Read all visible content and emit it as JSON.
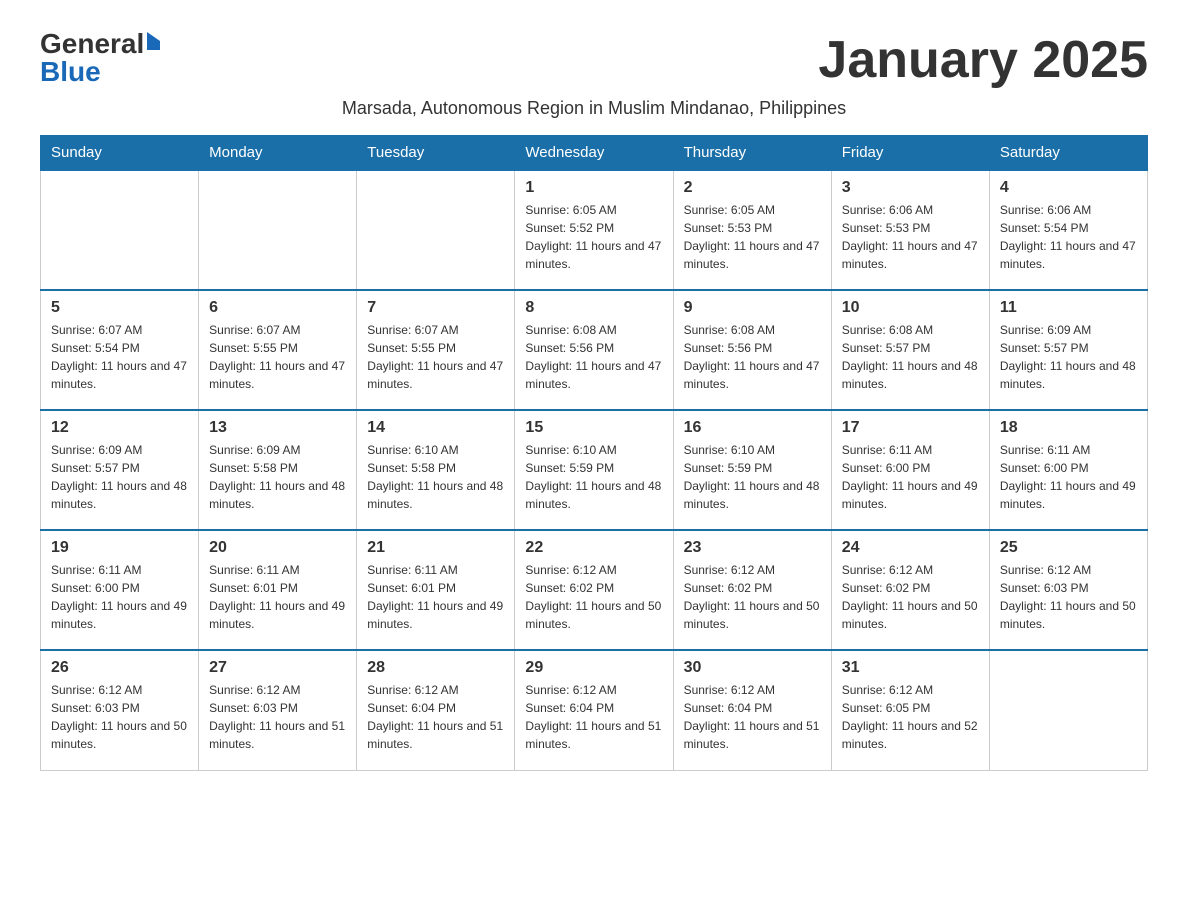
{
  "logo": {
    "general": "General",
    "blue": "Blue",
    "arrow": "▶"
  },
  "title": "January 2025",
  "subtitle": "Marsada, Autonomous Region in Muslim Mindanao, Philippines",
  "days_of_week": [
    "Sunday",
    "Monday",
    "Tuesday",
    "Wednesday",
    "Thursday",
    "Friday",
    "Saturday"
  ],
  "weeks": [
    [
      {
        "day": "",
        "info": ""
      },
      {
        "day": "",
        "info": ""
      },
      {
        "day": "",
        "info": ""
      },
      {
        "day": "1",
        "info": "Sunrise: 6:05 AM\nSunset: 5:52 PM\nDaylight: 11 hours and 47 minutes."
      },
      {
        "day": "2",
        "info": "Sunrise: 6:05 AM\nSunset: 5:53 PM\nDaylight: 11 hours and 47 minutes."
      },
      {
        "day": "3",
        "info": "Sunrise: 6:06 AM\nSunset: 5:53 PM\nDaylight: 11 hours and 47 minutes."
      },
      {
        "day": "4",
        "info": "Sunrise: 6:06 AM\nSunset: 5:54 PM\nDaylight: 11 hours and 47 minutes."
      }
    ],
    [
      {
        "day": "5",
        "info": "Sunrise: 6:07 AM\nSunset: 5:54 PM\nDaylight: 11 hours and 47 minutes."
      },
      {
        "day": "6",
        "info": "Sunrise: 6:07 AM\nSunset: 5:55 PM\nDaylight: 11 hours and 47 minutes."
      },
      {
        "day": "7",
        "info": "Sunrise: 6:07 AM\nSunset: 5:55 PM\nDaylight: 11 hours and 47 minutes."
      },
      {
        "day": "8",
        "info": "Sunrise: 6:08 AM\nSunset: 5:56 PM\nDaylight: 11 hours and 47 minutes."
      },
      {
        "day": "9",
        "info": "Sunrise: 6:08 AM\nSunset: 5:56 PM\nDaylight: 11 hours and 47 minutes."
      },
      {
        "day": "10",
        "info": "Sunrise: 6:08 AM\nSunset: 5:57 PM\nDaylight: 11 hours and 48 minutes."
      },
      {
        "day": "11",
        "info": "Sunrise: 6:09 AM\nSunset: 5:57 PM\nDaylight: 11 hours and 48 minutes."
      }
    ],
    [
      {
        "day": "12",
        "info": "Sunrise: 6:09 AM\nSunset: 5:57 PM\nDaylight: 11 hours and 48 minutes."
      },
      {
        "day": "13",
        "info": "Sunrise: 6:09 AM\nSunset: 5:58 PM\nDaylight: 11 hours and 48 minutes."
      },
      {
        "day": "14",
        "info": "Sunrise: 6:10 AM\nSunset: 5:58 PM\nDaylight: 11 hours and 48 minutes."
      },
      {
        "day": "15",
        "info": "Sunrise: 6:10 AM\nSunset: 5:59 PM\nDaylight: 11 hours and 48 minutes."
      },
      {
        "day": "16",
        "info": "Sunrise: 6:10 AM\nSunset: 5:59 PM\nDaylight: 11 hours and 48 minutes."
      },
      {
        "day": "17",
        "info": "Sunrise: 6:11 AM\nSunset: 6:00 PM\nDaylight: 11 hours and 49 minutes."
      },
      {
        "day": "18",
        "info": "Sunrise: 6:11 AM\nSunset: 6:00 PM\nDaylight: 11 hours and 49 minutes."
      }
    ],
    [
      {
        "day": "19",
        "info": "Sunrise: 6:11 AM\nSunset: 6:00 PM\nDaylight: 11 hours and 49 minutes."
      },
      {
        "day": "20",
        "info": "Sunrise: 6:11 AM\nSunset: 6:01 PM\nDaylight: 11 hours and 49 minutes."
      },
      {
        "day": "21",
        "info": "Sunrise: 6:11 AM\nSunset: 6:01 PM\nDaylight: 11 hours and 49 minutes."
      },
      {
        "day": "22",
        "info": "Sunrise: 6:12 AM\nSunset: 6:02 PM\nDaylight: 11 hours and 50 minutes."
      },
      {
        "day": "23",
        "info": "Sunrise: 6:12 AM\nSunset: 6:02 PM\nDaylight: 11 hours and 50 minutes."
      },
      {
        "day": "24",
        "info": "Sunrise: 6:12 AM\nSunset: 6:02 PM\nDaylight: 11 hours and 50 minutes."
      },
      {
        "day": "25",
        "info": "Sunrise: 6:12 AM\nSunset: 6:03 PM\nDaylight: 11 hours and 50 minutes."
      }
    ],
    [
      {
        "day": "26",
        "info": "Sunrise: 6:12 AM\nSunset: 6:03 PM\nDaylight: 11 hours and 50 minutes."
      },
      {
        "day": "27",
        "info": "Sunrise: 6:12 AM\nSunset: 6:03 PM\nDaylight: 11 hours and 51 minutes."
      },
      {
        "day": "28",
        "info": "Sunrise: 6:12 AM\nSunset: 6:04 PM\nDaylight: 11 hours and 51 minutes."
      },
      {
        "day": "29",
        "info": "Sunrise: 6:12 AM\nSunset: 6:04 PM\nDaylight: 11 hours and 51 minutes."
      },
      {
        "day": "30",
        "info": "Sunrise: 6:12 AM\nSunset: 6:04 PM\nDaylight: 11 hours and 51 minutes."
      },
      {
        "day": "31",
        "info": "Sunrise: 6:12 AM\nSunset: 6:05 PM\nDaylight: 11 hours and 52 minutes."
      },
      {
        "day": "",
        "info": ""
      }
    ]
  ]
}
